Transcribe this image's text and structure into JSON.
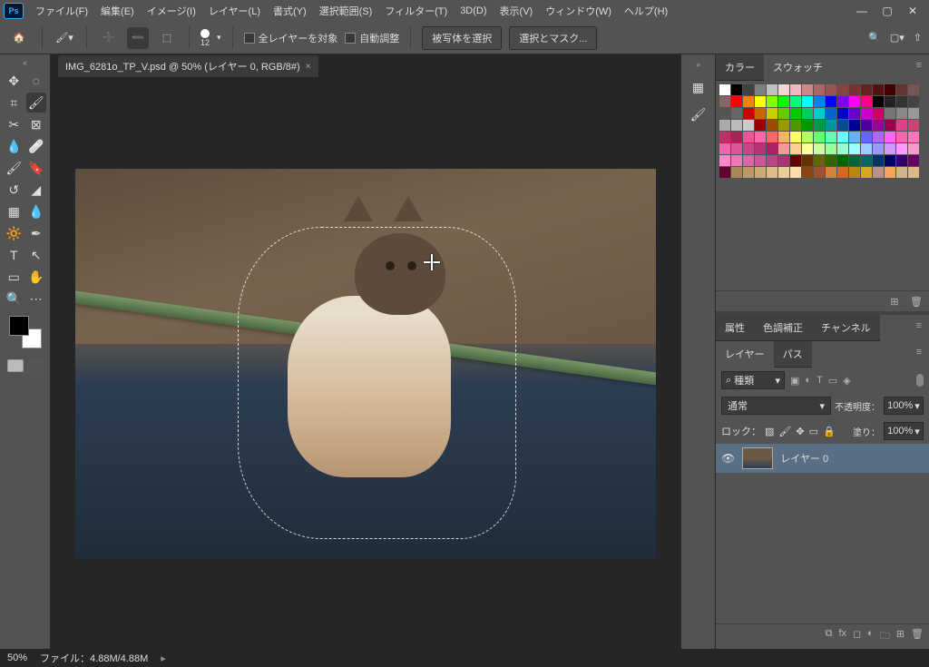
{
  "app": {
    "logo": "Ps"
  },
  "menu": [
    "ファイル(F)",
    "編集(E)",
    "イメージ(I)",
    "レイヤー(L)",
    "書式(Y)",
    "選択範囲(S)",
    "フィルター(T)",
    "3D(D)",
    "表示(V)",
    "ウィンドウ(W)",
    "ヘルプ(H)"
  ],
  "optbar": {
    "brush_size": "12",
    "check1": "全レイヤーを対象",
    "check2": "自動調整",
    "btn1": "被写体を選択",
    "btn2": "選択とマスク..."
  },
  "document": {
    "tab_title": "IMG_6281o_TP_V.psd @ 50% (レイヤー 0, RGB/8#)",
    "zoom": "50%",
    "filesize": "ファイル：4.88M/4.88M"
  },
  "panels": {
    "color_tab": "カラー",
    "swatch_tab": "スウォッチ",
    "prop_tab": "属性",
    "adj_tab": "色調補正",
    "chan_tab": "チャンネル",
    "layers_tab": "レイヤー",
    "paths_tab": "パス",
    "filter_label": "種類",
    "blend_mode": "通常",
    "opacity_label": "不透明度：",
    "opacity_value": "100%",
    "lock_label": "ロック：",
    "fill_label": "塗り：",
    "fill_value": "100%",
    "layer0_name": "レイヤー 0",
    "search_icon": "⌕"
  },
  "swatch_colors": [
    "#ffffff",
    "#000000",
    "#404040",
    "#808080",
    "#c0c0c0",
    "#f5d5d5",
    "#f0b8b8",
    "#c88",
    "#a66",
    "#955",
    "#844",
    "#733",
    "#622",
    "#511",
    "#400",
    "#633",
    "#755",
    "#866",
    "#ff0000",
    "#ff8000",
    "#ffff00",
    "#80ff00",
    "#00ff00",
    "#00ff80",
    "#00ffff",
    "#0080ff",
    "#0000ff",
    "#8000ff",
    "#ff00ff",
    "#ff0080",
    "#000000",
    "#222",
    "#333",
    "#444",
    "#555",
    "#666",
    "#cc0000",
    "#cc6600",
    "#cccc00",
    "#66cc00",
    "#00cc00",
    "#00cc66",
    "#00cccc",
    "#0066cc",
    "#0000cc",
    "#6600cc",
    "#cc00cc",
    "#cc0066",
    "#777",
    "#888",
    "#999",
    "#aaa",
    "#bbb",
    "#ccc",
    "#990000",
    "#994c00",
    "#999900",
    "#4c9900",
    "#009900",
    "#00994c",
    "#009999",
    "#004c99",
    "#000099",
    "#4c0099",
    "#990099",
    "#99004c",
    "#d48",
    "#c47",
    "#b36",
    "#a25",
    "#e59",
    "#f6a",
    "#ff6666",
    "#ffb266",
    "#ffff66",
    "#b2ff66",
    "#66ff66",
    "#66ffb2",
    "#66ffff",
    "#66b2ff",
    "#6666ff",
    "#b266ff",
    "#ff66ff",
    "#ff66b2",
    "#f7b",
    "#e6a",
    "#d59",
    "#c48",
    "#b37",
    "#a26",
    "#ff9999",
    "#ffcc99",
    "#ffff99",
    "#ccff99",
    "#99ff99",
    "#99ffcc",
    "#99ffff",
    "#99ccff",
    "#9999ff",
    "#cc99ff",
    "#ff99ff",
    "#ff99cc",
    "#f8c",
    "#e7b",
    "#d6a",
    "#c59",
    "#b48",
    "#a37",
    "#660000",
    "#663300",
    "#666600",
    "#336600",
    "#006600",
    "#006633",
    "#006666",
    "#003366",
    "#000066",
    "#330066",
    "#660066",
    "#660033",
    "#a85",
    "#b96",
    "#ca7",
    "#db8",
    "#ec9",
    "#fda",
    "#8b4513",
    "#a0522d",
    "#cd853f",
    "#d2691e",
    "#b8860b",
    "#daa520",
    "#bc8f8f",
    "#f4a460",
    "#d2b48c",
    "#deb887"
  ]
}
